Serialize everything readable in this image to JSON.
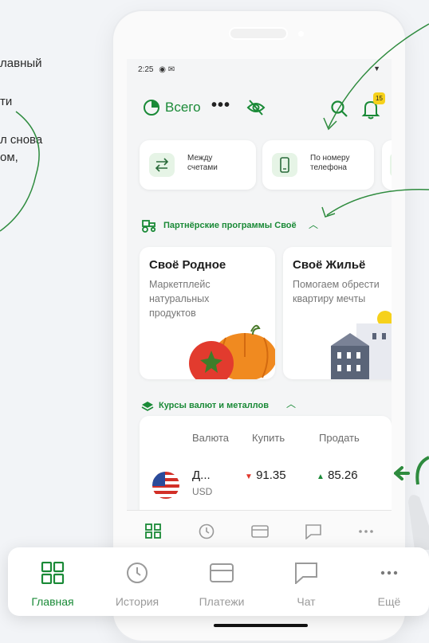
{
  "side_text": [
    "лавный",
    "ти",
    "л снова",
    "ом,"
  ],
  "status_bar": {
    "time": "2:25"
  },
  "header": {
    "account_label": "Всего",
    "menu_dots": "•••",
    "notification_count": "15"
  },
  "quick_actions": [
    {
      "label": "Между\nсчетами",
      "icon": "transfer-icon"
    },
    {
      "label": "По номеру\nтелефона",
      "icon": "phone-icon"
    }
  ],
  "partner_section": {
    "title": "Партнёрские программы Своё",
    "icon": "tractor-icon"
  },
  "promos": [
    {
      "title": "Своё Родное",
      "description": "Маркетплейс\nнатуральных\nпродуктов"
    },
    {
      "title": "Своё Жильё",
      "description": "Помогаем обрести\nквартиру мечты"
    }
  ],
  "rates_section": {
    "title": "Курсы валют и металлов",
    "icon": "layers-icon"
  },
  "rates_table": {
    "headers": [
      "Валюта",
      "Купить",
      "Продать"
    ],
    "rows": [
      {
        "name": "Д...",
        "code": "USD",
        "buy": "91.35",
        "buy_trend": "down",
        "sell": "85.26",
        "sell_trend": "up"
      }
    ]
  },
  "bottom_nav": [
    {
      "label": "Главная",
      "icon": "home-grid-icon",
      "active": true
    },
    {
      "label": "История",
      "icon": "clock-icon",
      "active": false
    },
    {
      "label": "Платежи",
      "icon": "card-icon",
      "active": false
    },
    {
      "label": "Чат",
      "icon": "chat-icon",
      "active": false
    },
    {
      "label": "Ещё",
      "icon": "more-icon",
      "active": false
    }
  ],
  "colors": {
    "brand_green": "#1a8a37",
    "badge_yellow": "#f6d11b",
    "trend_down": "#e0362b"
  }
}
